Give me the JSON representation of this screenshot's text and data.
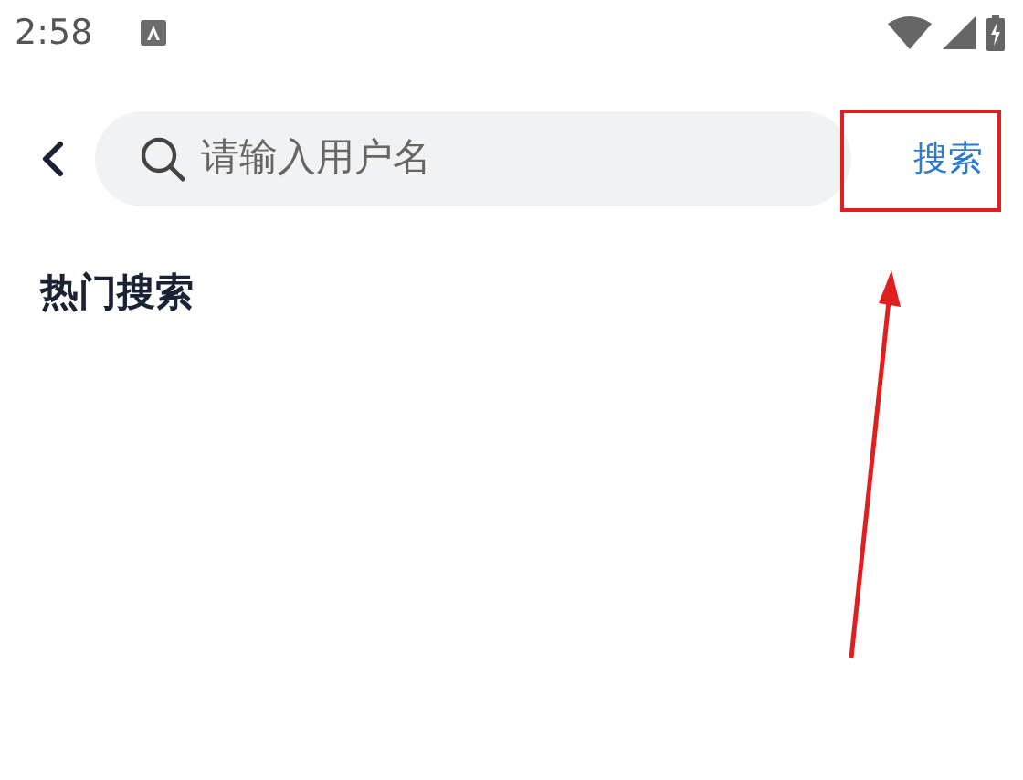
{
  "status_bar": {
    "time": "2:58"
  },
  "search": {
    "placeholder": "请输入用户名",
    "button": "搜索"
  },
  "section": {
    "title": "热门搜索"
  }
}
